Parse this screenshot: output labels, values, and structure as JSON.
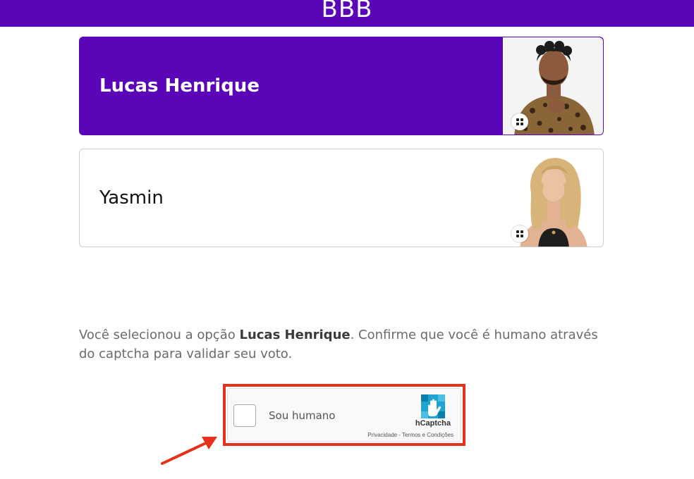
{
  "header": {
    "title": "BBB"
  },
  "options": [
    {
      "name": "Lucas Henrique",
      "selected": true
    },
    {
      "name": "Yasmin",
      "selected": false
    }
  ],
  "message": {
    "prefix": "Você selecionou a opção ",
    "selected_name": "Lucas Henrique",
    "suffix": ". Confirme que você é humano através do captcha para validar seu voto."
  },
  "captcha": {
    "label": "Sou humano",
    "brand": "hCaptcha",
    "privacy": "Privacidade",
    "separator": " - ",
    "terms": "Termos e Condições"
  },
  "colors": {
    "accent": "#5a05b8",
    "annotation": "#e8311a",
    "captcha_logo": "#1fa4d4"
  },
  "icons": {
    "card_badge": "expand-grid-icon",
    "captcha_logo": "hcaptcha-hand-icon",
    "annotation": "red-arrow-icon"
  }
}
